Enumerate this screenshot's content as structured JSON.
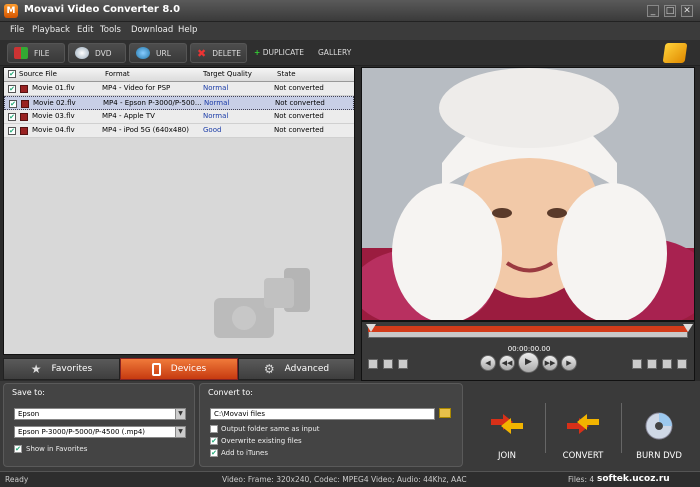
{
  "window": {
    "title": "Movavi Video Converter 8.0",
    "icon_label": "M",
    "min": "_",
    "max": "□",
    "close": "✕"
  },
  "menu": [
    "File",
    "Playback",
    "Edit",
    "Tools",
    "Download",
    "Help"
  ],
  "toolbar": {
    "file": "FILE",
    "dvd": "DVD",
    "url": "URL",
    "delete": "DELETE",
    "duplicate": "DUPLICATE",
    "gallery": "GALLERY"
  },
  "list": {
    "headers": {
      "source": "Source File",
      "format": "Format",
      "quality": "Target Quality",
      "state": "State"
    },
    "rows": [
      {
        "file": "Movie 01.flv",
        "format": "MP4 - Video for PSP",
        "quality": "Normal",
        "state": "Not converted"
      },
      {
        "file": "Movie 02.flv",
        "format": "MP4 - Epson P-3000/P-500...",
        "quality": "Normal",
        "state": "Not converted"
      },
      {
        "file": "Movie 03.flv",
        "format": "MP4 - Apple TV",
        "quality": "Normal",
        "state": "Not converted"
      },
      {
        "file": "Movie 04.flv",
        "format": "MP4 - iPod 5G (640x480)",
        "quality": "Good",
        "state": "Not converted"
      }
    ]
  },
  "tabs": {
    "favorites": "Favorites",
    "devices": "Devices",
    "advanced": "Advanced"
  },
  "player": {
    "timecode": "00:00:00.00"
  },
  "save": {
    "title": "Save to:",
    "device": "Epson",
    "profile": "Epson P-3000/P-5000/P-4500 (.mp4)",
    "favorites": "Show in Favorites"
  },
  "convert": {
    "title": "Convert to:",
    "folder": "C:\\Movavi files",
    "opt1": "Output folder same as input",
    "opt2": "Overwrite existing files",
    "opt3": "Add to iTunes"
  },
  "actions": {
    "join": "JOIN",
    "convert": "CONVERT",
    "burn": "BURN DVD"
  },
  "status": {
    "left": "Ready",
    "info": "Video: Frame: 320x240, Codec: MPEG4 Video; Audio: 44Khz, AAC",
    "files": "Files: 4",
    "watermark": "softek.ucoz.ru"
  },
  "colors": {
    "accent": "#d94a1a",
    "quality": "#1b3ca8"
  }
}
